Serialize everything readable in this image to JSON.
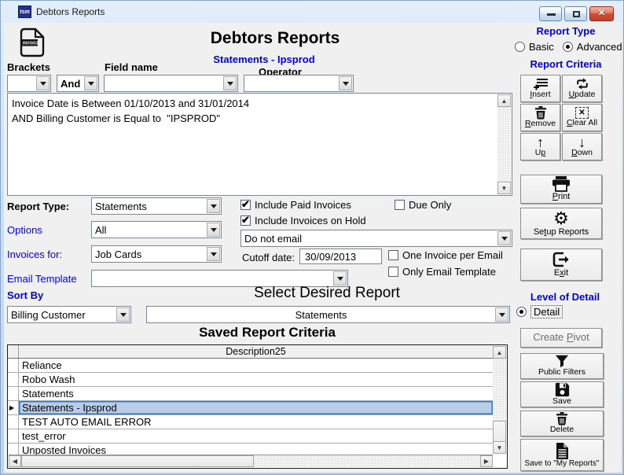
{
  "window": {
    "title": "Debtors Reports",
    "app_icon_text": "tsm"
  },
  "header": {
    "title": "Debtors Reports",
    "subtitle": "Statements - Ipsprod",
    "invoice_icon_text": "INVOICE"
  },
  "report_type": {
    "label": "Report Type",
    "basic": "Basic",
    "advanced": "Advanced",
    "selected": "Advanced"
  },
  "builder": {
    "brackets_label": "Brackets",
    "field_name_label": "Field name",
    "operator_label": "Operator",
    "bool_value": "And",
    "criteria_line1": "Invoice Date is Between 01/10/2013 and 31/01/2014",
    "criteria_line2": "AND Billing Customer is Equal to  \"IPSPROD\""
  },
  "criteria_panel": {
    "heading": "Report Criteria",
    "insert": "Insert",
    "update": "Update",
    "remove": "Remove",
    "clear_all": "Clear All",
    "up": "Up",
    "down": "Down"
  },
  "actions": {
    "print": "Print",
    "setup_reports": "Setup Reports",
    "exit": "Exit"
  },
  "form": {
    "report_type_label": "Report Type:",
    "report_type_value": "Statements",
    "options_label": "Options",
    "options_value": "All",
    "invoices_for_label": "Invoices for:",
    "invoices_for_value": "Job Cards",
    "email_template_label": "Email Template",
    "email_template_value": "",
    "include_paid_label": "Include Paid Invoices",
    "due_only_label": "Due Only",
    "include_hold_label": "Include Invoices on Hold",
    "email_mode_value": "Do not email",
    "cutoff_label": "Cutoff date:",
    "cutoff_value": "30/09/2013",
    "one_invoice_label": "One Invoice per Email",
    "only_template_label": "Only Email Template",
    "sort_by_label": "Sort By",
    "sort_by_value": "Billing Customer",
    "select_report_heading": "Select Desired Report",
    "selected_report_value": "Statements"
  },
  "saved_reports": {
    "heading": "Saved Report Criteria",
    "column_header": "Description25",
    "rows": [
      "Reliance",
      "Robo Wash",
      "Statements",
      "Statements - Ipsprod",
      "TEST AUTO EMAIL ERROR",
      "test_error",
      "Unposted Invoices"
    ],
    "selected_row": "Statements - Ipsprod"
  },
  "detail_panel": {
    "heading": "Level of Detail",
    "detail_label": "Detail"
  },
  "side_actions": {
    "create_pivot": "Create Pivot",
    "public_filters": "Public Filters",
    "save": "Save",
    "delete": "Delete",
    "save_to_my_reports": "Save to \"My Reports\""
  },
  "colors": {
    "label_blue": "#0000ee",
    "selection_fill": "#b9cde9",
    "selection_border": "#4673a8",
    "titlebar_blue": "#cde0f2",
    "close_red": "#c2402c"
  }
}
